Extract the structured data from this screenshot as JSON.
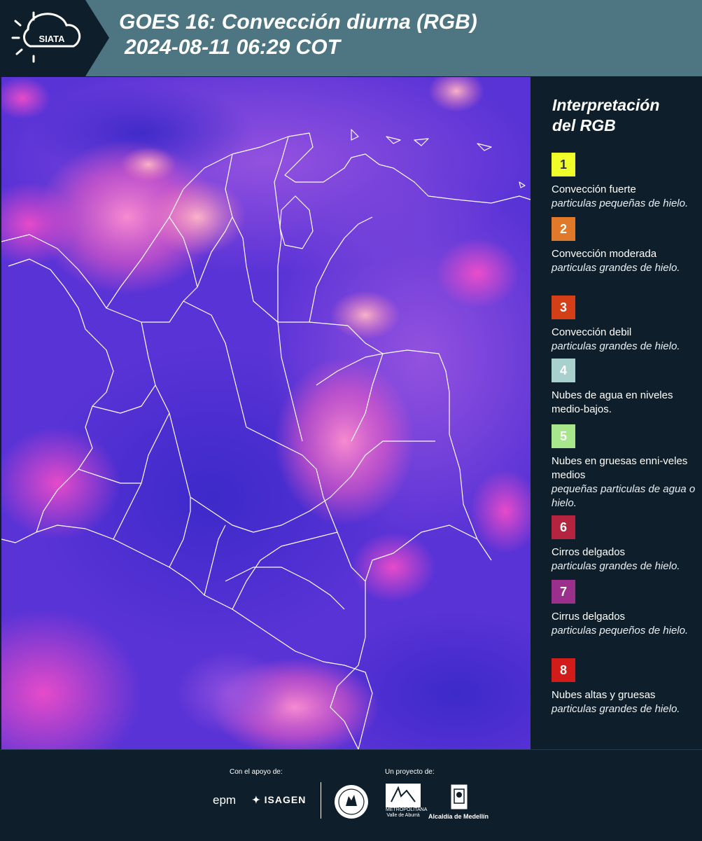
{
  "header": {
    "logo_text": "SIATA",
    "title_line1": "GOES 16: Convección diurna (RGB)",
    "title_line2": "2024-08-11 06:29 COT",
    "background": "#4e7682"
  },
  "map": {
    "description": "False-color satellite RGB imagery of Colombia with white department and country boundary lines",
    "base_color": "#4b2fd0",
    "boundary_color": "#ffffff"
  },
  "legend": {
    "title_line1": "Interpretación",
    "title_line2": "del RGB",
    "items": [
      {
        "number": "1",
        "color": "#f0ff2a",
        "label": "Convección fuerte",
        "sub": "particulas pequeñas de hielo."
      },
      {
        "number": "2",
        "color": "#e0792a",
        "label": "Convección moderada",
        "sub": "particulas grandes de hielo."
      },
      {
        "number": "3",
        "color": "#d43f18",
        "label": "Convección debil",
        "sub": "particulas grandes de hielo."
      },
      {
        "number": "4",
        "color": "#a8d0cc",
        "label": "Nubes de agua en niveles medio-bajos.",
        "sub": ""
      },
      {
        "number": "5",
        "color": "#a8e68c",
        "label": "Nubes en gruesas enni-veles medios",
        "sub": "pequeñas particulas de agua o hielo."
      },
      {
        "number": "6",
        "color": "#b5243f",
        "label": "Cirros delgados",
        "sub": "particulas grandes de hielo."
      },
      {
        "number": "7",
        "color": "#9b2f8c",
        "label": "Cirrus delgados",
        "sub": "particulas pequeños de hielo."
      },
      {
        "number": "8",
        "color": "#d21c1a",
        "label": "Nubes altas y gruesas",
        "sub": "particulas grandes de hielo."
      }
    ]
  },
  "footer": {
    "support_label": "Con el apoyo de:",
    "project_label": "Un proyecto de:",
    "sponsor_1": "epm",
    "sponsor_2": "ISAGEN",
    "partner_area_text": "METROPOLITANA Valle de Aburrá",
    "partner_alcaldia": "Alcaldía de Medellín"
  }
}
